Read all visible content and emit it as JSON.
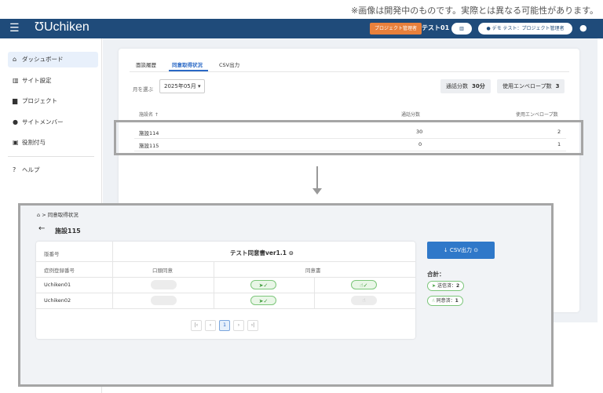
{
  "note": "※画像は開発中のものです。実際とは異なる可能性があります。",
  "header": {
    "menu_icon": "☰",
    "logo": "Uchiken",
    "role_badge": "プロジェクト管理者",
    "project_name": "テスト01",
    "building_icon": "▥",
    "user_label": "デモ テスト：プロジェクト管理者"
  },
  "sidebar": {
    "items": [
      {
        "label": "ダッシュボード",
        "icon": "home-icon"
      },
      {
        "label": "サイト設定",
        "icon": "building-icon"
      },
      {
        "label": "プロジェクト",
        "icon": "folder-icon"
      },
      {
        "label": "サイトメンバー",
        "icon": "person-icon"
      },
      {
        "label": "役割付与",
        "icon": "badge-icon"
      }
    ],
    "help": "ヘルプ"
  },
  "main": {
    "tabs": [
      "面談履歴",
      "同意取得状況",
      "CSV出力"
    ],
    "month_label": "月を選ぶ",
    "month_value": "2025年05月 ▾",
    "call_minutes_label": "通話分数",
    "call_minutes_value": "30分",
    "envelope_label": "使用エンベロープ数",
    "envelope_value": "3",
    "table": {
      "headers": [
        "施設名 ↑",
        "通話分数",
        "使用エンベロープ数"
      ],
      "rows": [
        [
          "施設114",
          "30",
          "2"
        ],
        [
          "施設115",
          "0",
          "1"
        ]
      ]
    }
  },
  "detail": {
    "breadcrumb": "⌂ > 同意取得状況",
    "back_icon": "←",
    "title": "施設115",
    "col_header_1": "版番号",
    "doc_title": "テスト同意書ver1.1 ⊙",
    "col_header_2": "症例登録番号",
    "col_oral": "口頭同意",
    "col_doc": "同意書",
    "rows": [
      {
        "id": "Uchiken01",
        "sent": "➤✓",
        "agreed": "☝✓"
      },
      {
        "id": "Uchiken02",
        "sent": "➤✓",
        "agreed": "☝"
      }
    ],
    "pager": [
      "|‹",
      "‹",
      "1",
      "›",
      "›|"
    ],
    "csv_button": "↓ CSV出力 ⊙",
    "total_label": "合計：",
    "sent_chip_icon": "➤",
    "sent_chip_label": "送信済：",
    "sent_chip_value": "2",
    "agreed_chip_icon": "☝",
    "agreed_chip_label": "同意済：",
    "agreed_chip_value": "1"
  },
  "colors": {
    "header": "#1f4b7a",
    "accent": "#2a69c6",
    "badge": "#e8803c",
    "green": "#3f9c3c"
  }
}
